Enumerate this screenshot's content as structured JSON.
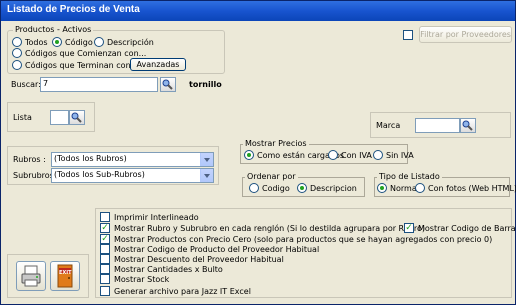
{
  "window": {
    "title": "Listado de Precios de Venta"
  },
  "productos_group": {
    "legend": "Productos - Activos",
    "radios": [
      {
        "label": "Todos",
        "checked": false
      },
      {
        "label": "Código",
        "checked": true
      },
      {
        "label": "Descripción",
        "checked": false
      },
      {
        "label": "Códigos que Comienzan con...",
        "checked": false
      },
      {
        "label": "Códigos que Terminan con...",
        "checked": false
      }
    ],
    "avanzadas_label": "Avanzadas"
  },
  "filtrar_proveedores": {
    "label": "Filtrar por Proveedores",
    "checked": false
  },
  "buscar": {
    "label": "Buscar:",
    "value": "7",
    "result": "tornillo"
  },
  "lista": {
    "label": "Lista",
    "value": ""
  },
  "marca": {
    "label": "Marca",
    "value": ""
  },
  "mostrar_precios": {
    "legend": "Mostrar Precios",
    "options": [
      {
        "label": "Como están cargados",
        "checked": true
      },
      {
        "label": "Con IVA",
        "checked": false
      },
      {
        "label": "Sin IVA",
        "checked": false
      }
    ]
  },
  "rubros": {
    "label": "Rubros :",
    "value": "(Todos los Rubros)"
  },
  "subrubros": {
    "label": "Subrubros :",
    "value": "(Todos los Sub-Rubros)"
  },
  "ordenar_por": {
    "legend": "Ordenar por",
    "options": [
      {
        "label": "Codigo",
        "checked": false
      },
      {
        "label": "Descripcion",
        "checked": true
      }
    ]
  },
  "tipo_listado": {
    "legend": "Tipo de Listado",
    "options": [
      {
        "label": "Normal",
        "checked": true
      },
      {
        "label": "Con fotos (Web HTML)",
        "checked": false
      }
    ]
  },
  "opciones": [
    {
      "label": "Imprimir Interlineado",
      "checked": false
    },
    {
      "label": "Mostrar Rubro y Subrubro en cada renglón (Si lo destilda agrupara por Rubro)",
      "checked": true
    },
    {
      "label": "Mostrar Productos con Precio Cero  (solo para productos que se hayan agregados con precio 0)",
      "checked": true
    },
    {
      "label": "Mostrar Codigo de Producto del Proveedor Habitual",
      "checked": false
    },
    {
      "label": "Mostrar Descuento del Proveedor Habitual",
      "checked": false
    },
    {
      "label": "Mostrar Cantidades x Bulto",
      "checked": false
    },
    {
      "label": "Mostrar Stock",
      "checked": false
    },
    {
      "label": "Generar archivo para Jazz IT Excel",
      "checked": false
    }
  ],
  "mostrar_codigo_barras": {
    "label": "Mostrar Codigo de Barras",
    "checked": true
  },
  "exit_label": "EXIT",
  "colors": {
    "title_bar": "#1854cf",
    "window_bg": "#ece9d8",
    "check_mark": "#21a121"
  }
}
